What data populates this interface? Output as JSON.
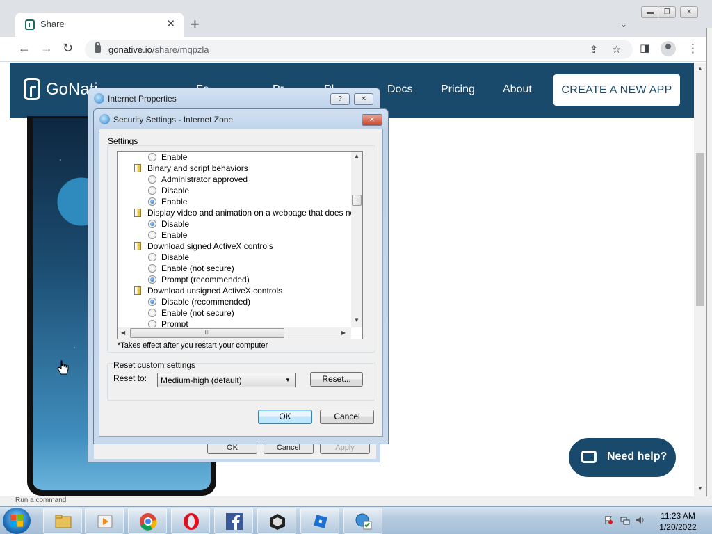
{
  "browser": {
    "tab_title": "Share",
    "tab_close": "✕",
    "new_tab": "+",
    "tab_search": "⌄",
    "back": "←",
    "forward": "→",
    "reload": "↻",
    "url_domain": "gonative.io",
    "url_path": "/share/mqpzla",
    "share_icon": "⇪",
    "bookmark_icon": "☆",
    "sidepanel_icon": "◨",
    "menu_icon": "⋮",
    "win_min": "▬",
    "win_restore": "❐",
    "win_close": "✕"
  },
  "site": {
    "brand": "GoNati",
    "nav": [
      "Fe",
      "Pr",
      "Pl",
      "Docs",
      "Pricing",
      "About"
    ],
    "cta": "CREATE A NEW APP",
    "help": "Need help?",
    "brand_color": "#1a4a6b"
  },
  "status": {
    "command": "Run a command"
  },
  "internet_properties": {
    "title": "Internet Properties",
    "help_btn": "?",
    "close_btn": "✕",
    "buttons": [
      "OK",
      "Cancel",
      "Apply"
    ]
  },
  "security_settings": {
    "title": "Security Settings - Internet Zone",
    "close_btn": "✕",
    "settings_label": "Settings",
    "rows": [
      {
        "type": "option",
        "label": "Enable",
        "checked": false
      },
      {
        "type": "group",
        "label": "Binary and script behaviors"
      },
      {
        "type": "option",
        "label": "Administrator approved",
        "checked": false
      },
      {
        "type": "option",
        "label": "Disable",
        "checked": false
      },
      {
        "type": "option",
        "label": "Enable",
        "checked": true
      },
      {
        "type": "group",
        "label": "Display video and animation on a webpage that does not use"
      },
      {
        "type": "option",
        "label": "Disable",
        "checked": true
      },
      {
        "type": "option",
        "label": "Enable",
        "checked": false
      },
      {
        "type": "group",
        "label": "Download signed ActiveX controls"
      },
      {
        "type": "option",
        "label": "Disable",
        "checked": false
      },
      {
        "type": "option",
        "label": "Enable (not secure)",
        "checked": false
      },
      {
        "type": "option",
        "label": "Prompt (recommended)",
        "checked": true
      },
      {
        "type": "group",
        "label": "Download unsigned ActiveX controls"
      },
      {
        "type": "option",
        "label": "Disable (recommended)",
        "checked": true
      },
      {
        "type": "option",
        "label": "Enable (not secure)",
        "checked": false
      },
      {
        "type": "option",
        "label": "Prompt",
        "checked": false
      }
    ],
    "scroll_up": "▲",
    "scroll_down": "▼",
    "scroll_left": "◀",
    "scroll_right": "▶",
    "hscroll_grip": "III",
    "footnote": "*Takes effect after you restart your computer",
    "reset_group_title": "Reset custom settings",
    "reset_to_label": "Reset to:",
    "reset_value": "Medium-high (default)",
    "reset_button": "Reset...",
    "ok": "OK",
    "cancel": "Cancel"
  },
  "taskbar": {
    "time": "11:23 AM",
    "date": "1/20/2022",
    "apps": [
      "file-explorer",
      "media-player",
      "chrome",
      "opera",
      "facebook",
      "unity",
      "roblox",
      "internet-options"
    ]
  }
}
